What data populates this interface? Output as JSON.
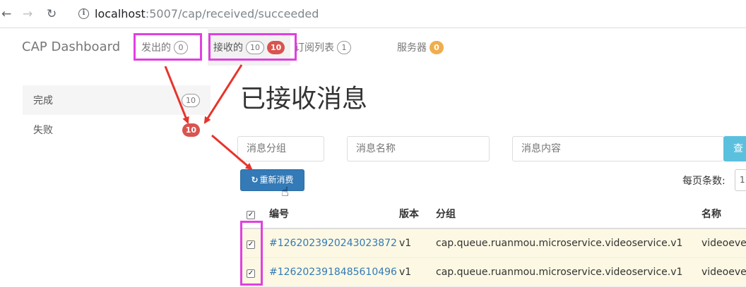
{
  "browser": {
    "url_host": "localhost",
    "url_path": ":5007/cap/received/succeeded",
    "back_icon": "arrow-left-icon",
    "forward_icon": "arrow-right-icon",
    "reload_icon": "reload-icon",
    "info_icon": "info-icon"
  },
  "navbar": {
    "brand": "CAP Dashboard",
    "items": [
      {
        "label": "发出的",
        "count": "0"
      },
      {
        "label": "接收的",
        "count": "10",
        "failed_count": "10"
      },
      {
        "label": "订阅列表",
        "count": "1"
      },
      {
        "label": "服务器",
        "count": "0"
      }
    ]
  },
  "sidebar": {
    "items": [
      {
        "label": "完成",
        "count": "10"
      },
      {
        "label": "失败",
        "count": "10"
      }
    ]
  },
  "main": {
    "title": "已接收消息",
    "filters": {
      "group_placeholder": "消息分组",
      "name_placeholder": "消息名称",
      "content_placeholder": "消息内容",
      "search_label": "查询"
    },
    "requeue_label": "重新消费",
    "page_size_label": "每页条数:",
    "page_size_value": "1"
  },
  "table": {
    "headers": {
      "id": "编号",
      "version": "版本",
      "group": "分组",
      "name": "名称"
    },
    "rows": [
      {
        "id": "#1262023920243023872",
        "version": "v1",
        "group": "cap.queue.ruanmou.microservice.videoservice.v1",
        "name": "videoevent"
      },
      {
        "id": "#1262023918485610496",
        "version": "v1",
        "group": "cap.queue.ruanmou.microservice.videoservice.v1",
        "name": "videoevent"
      }
    ]
  },
  "colors": {
    "highlight": "#e040e0",
    "arrow": "#e8332a",
    "primary": "#337ab7",
    "danger": "#d9534f",
    "warning": "#f0ad4e",
    "info": "#5bc0de",
    "row_highlight": "#fcf8e3"
  }
}
